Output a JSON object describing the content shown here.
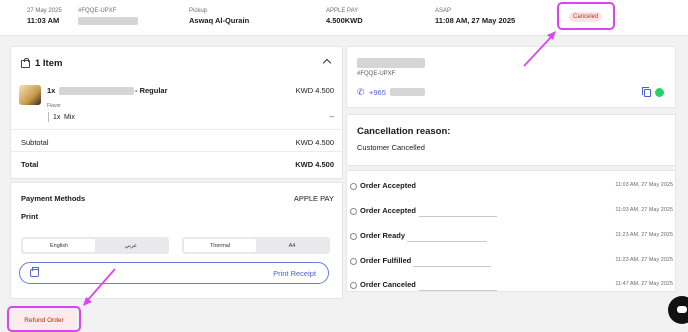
{
  "header": {
    "date_small": "27 May 2025",
    "time": "11:03 AM",
    "order_id": "#FQQE-UPXF",
    "pickup_label": "Pickup",
    "branch": "Aswaq Al-Qurain",
    "payment_label": "APPLE PAY",
    "amount": "4.500KWD",
    "asap_label": "ASAP",
    "asap_time": "11:08 AM, 27 May 2025",
    "status": "Canceled"
  },
  "items": {
    "title": "1 Item",
    "qty": "1x",
    "name_suffix": "- Regular",
    "price": "KWD 4.500",
    "option_group": "Flavor",
    "option_qty": "1x",
    "option_name": "Mix",
    "option_price": "--",
    "subtotal_label": "Subtotal",
    "subtotal_value": "KWD 4.500",
    "total_label": "Total",
    "total_value": "KWD 4.500"
  },
  "payment": {
    "methods_label": "Payment Methods",
    "methods_value": "APPLE PAY",
    "print_label": "Print",
    "lang_options": [
      "English",
      "عربي"
    ],
    "paper_options": [
      "Thermal",
      "A4"
    ],
    "print_receipt": "Print Receipt"
  },
  "customer": {
    "order_id": "#FQQE-UPXF",
    "phone_prefix": "+965"
  },
  "cancellation": {
    "title": "Cancellation reason:",
    "reason": "Customer Cancelled"
  },
  "timeline": [
    {
      "label": "Order Accepted",
      "time": "11:03 AM, 27 May 2025"
    },
    {
      "label": "Order Accepted",
      "time": "11:03 AM, 27 May 2025"
    },
    {
      "label": "Order Ready",
      "time": "11:23 AM, 27 May 2025"
    },
    {
      "label": "Order Fulfilled",
      "time": "11:23 AM, 27 May 2025"
    },
    {
      "label": "Order Canceled",
      "time": "11:47 AM, 27 May 2025"
    }
  ],
  "footer": {
    "refund_label": "Refund Order"
  },
  "icons": [
    "bag-icon",
    "chevron-up-icon",
    "phone-icon",
    "copy-icon",
    "whatsapp-icon",
    "printer-icon",
    "check-circle-icon",
    "chat-icon"
  ],
  "colors": {
    "accent": "#4a5fd0",
    "danger": "#c53030",
    "highlight": "#d946ef"
  }
}
